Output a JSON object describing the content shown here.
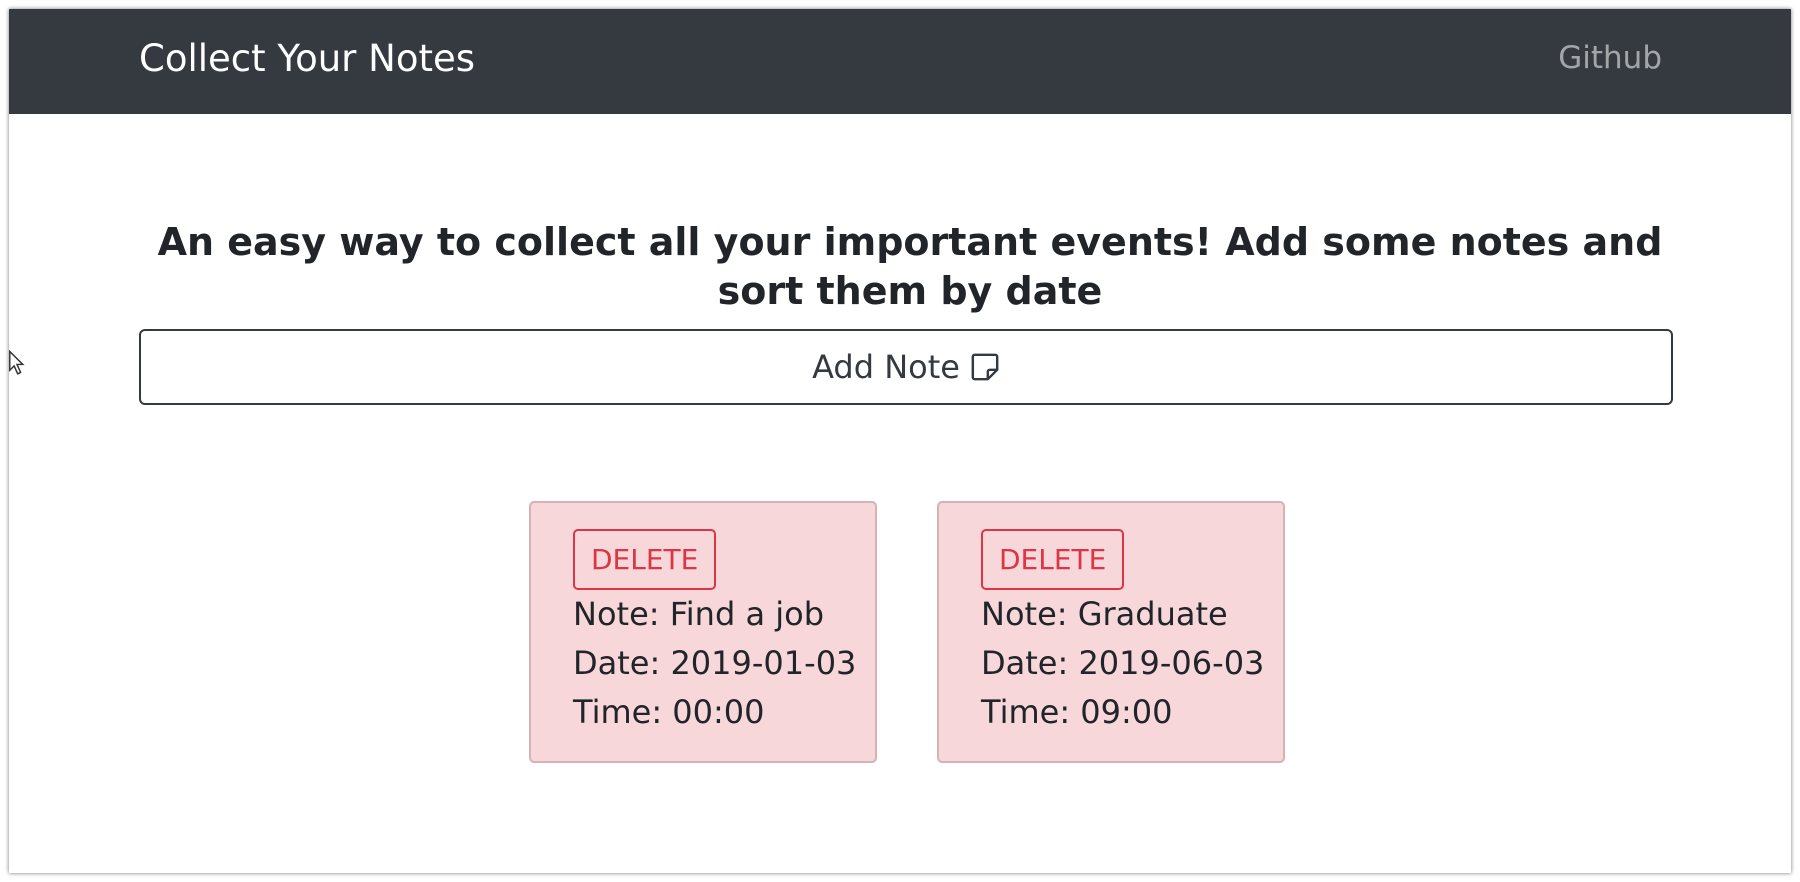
{
  "navbar": {
    "brand": "Collect Your Notes",
    "link": "Github"
  },
  "main": {
    "headline": "An easy way to collect all your important events! Add some notes and sort them by date",
    "add_button_label": "Add Note",
    "add_button_icon": "sticky-note-icon"
  },
  "notes": [
    {
      "delete_label": "DELETE",
      "note": "Note: Find a job",
      "date": "Date: 2019-01-03",
      "time": "Time: 00:00"
    },
    {
      "delete_label": "DELETE",
      "note": "Note: Graduate",
      "date": "Date: 2019-06-03",
      "time": "Time: 09:00"
    }
  ],
  "colors": {
    "navbar_bg": "#343a40",
    "card_bg": "#f8d7da",
    "danger": "#dc3545"
  }
}
